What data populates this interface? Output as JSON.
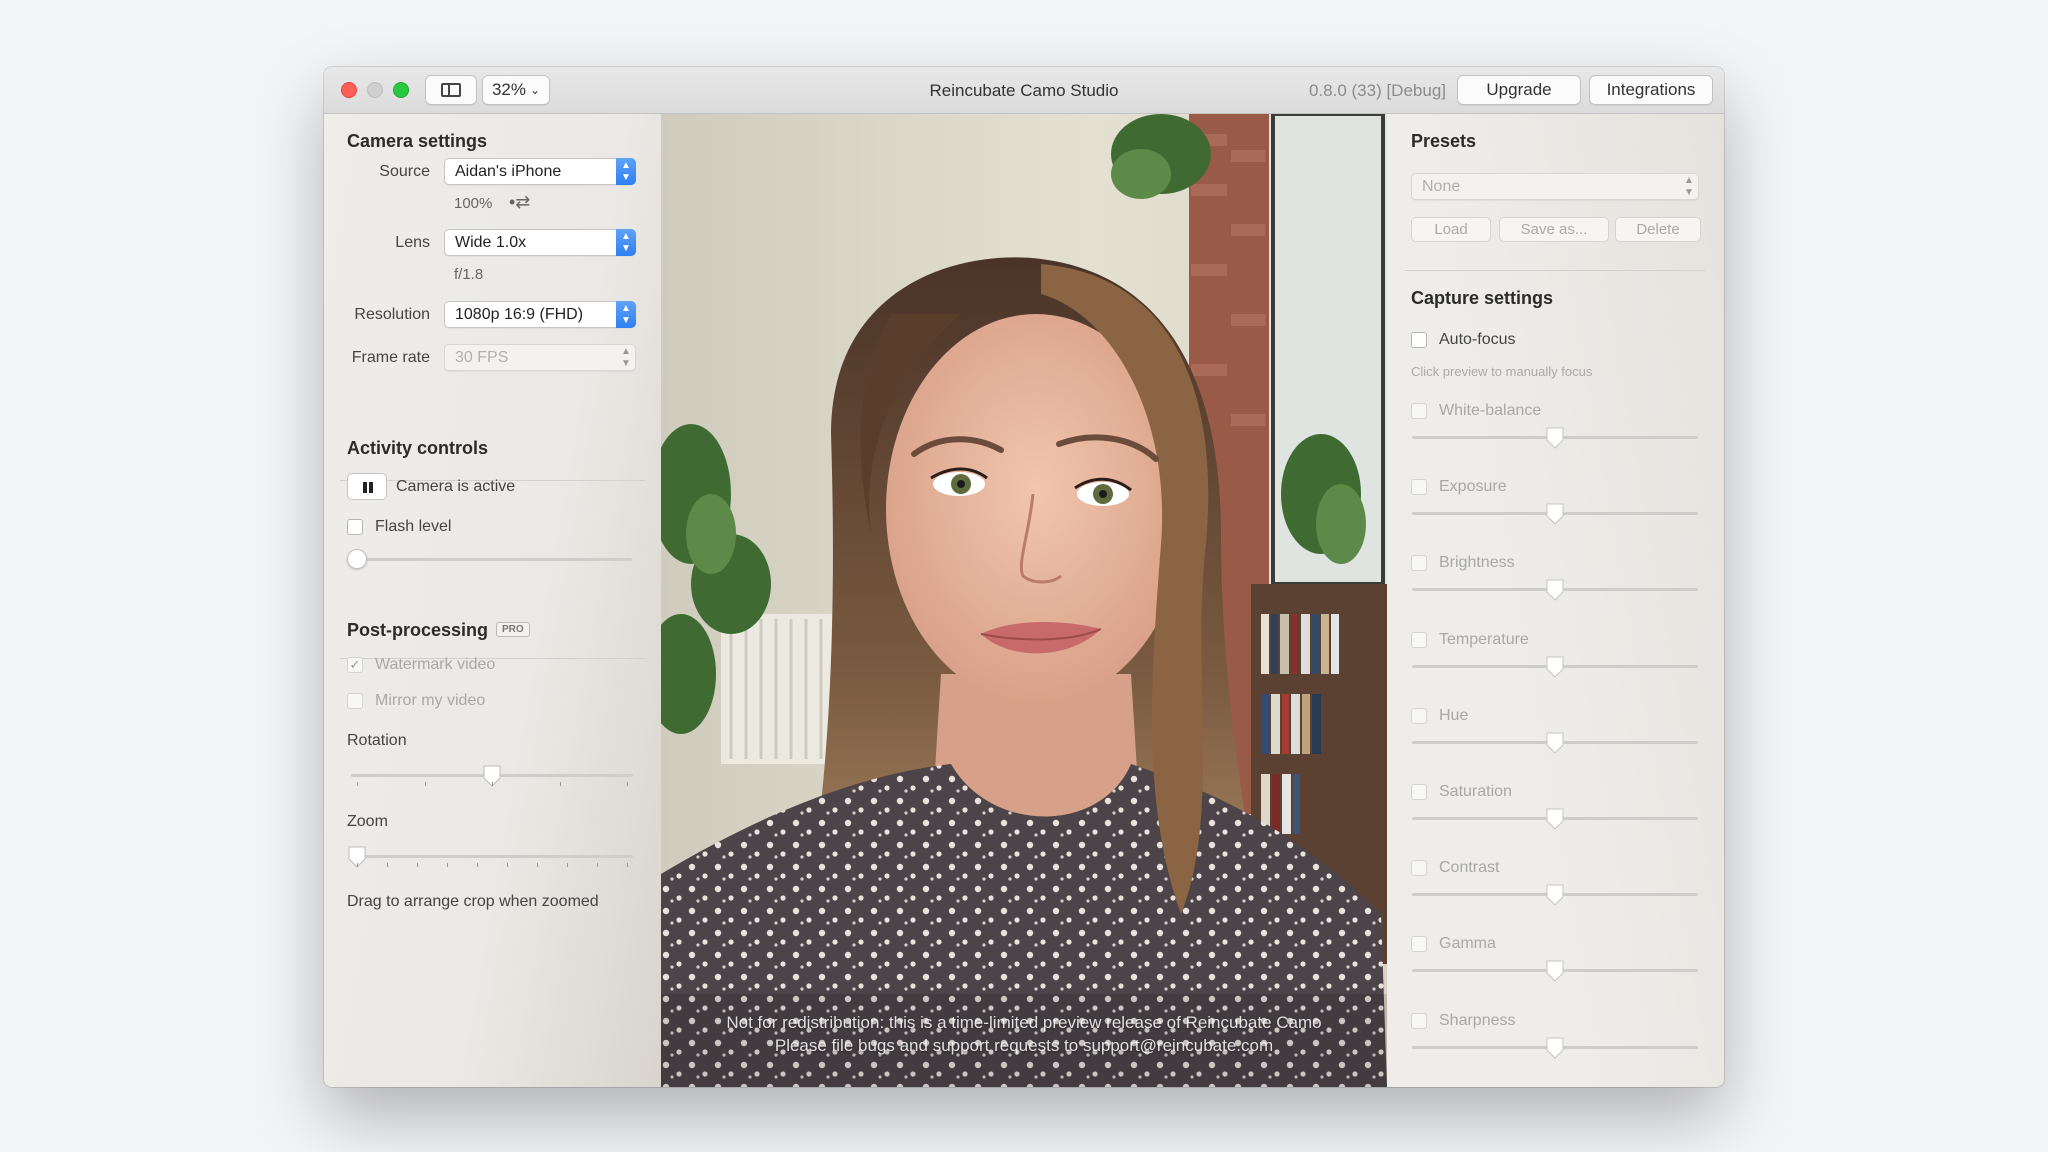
{
  "window": {
    "title": "Reincubate Camo Studio",
    "version": "0.8.0 (33) [Debug]",
    "zoom": "32%",
    "upgrade_label": "Upgrade",
    "integrations_label": "Integrations"
  },
  "camera_settings": {
    "title": "Camera settings",
    "source_label": "Source",
    "source_value": "Aidan's iPhone",
    "battery": "100%",
    "lens_label": "Lens",
    "lens_value": "Wide 1.0x",
    "aperture": "f/1.8",
    "resolution_label": "Resolution",
    "resolution_value": "1080p 16:9 (FHD)",
    "framerate_label": "Frame rate",
    "framerate_value": "30 FPS"
  },
  "activity_controls": {
    "title": "Activity controls",
    "camera_status": "Camera is active",
    "flash_label": "Flash level",
    "flash_level": 0
  },
  "post_processing": {
    "title": "Post-processing",
    "badge": "PRO",
    "watermark_label": "Watermark video",
    "watermark_checked": true,
    "mirror_label": "Mirror my video",
    "rotation_label": "Rotation",
    "rotation_value": 0.5,
    "zoom_label": "Zoom",
    "zoom_value": 0,
    "crop_hint": "Drag to arrange crop when zoomed"
  },
  "presets": {
    "title": "Presets",
    "selected": "None",
    "load_label": "Load",
    "save_label": "Save as...",
    "delete_label": "Delete"
  },
  "capture_settings": {
    "title": "Capture settings",
    "autofocus_label": "Auto-focus",
    "autofocus_hint": "Click preview to manually focus",
    "sliders": [
      {
        "label": "White-balance",
        "value": 0.5
      },
      {
        "label": "Exposure",
        "value": 0.5
      },
      {
        "label": "Brightness",
        "value": 0.5
      },
      {
        "label": "Temperature",
        "value": 0.5
      },
      {
        "label": "Hue",
        "value": 0.5
      },
      {
        "label": "Saturation",
        "value": 0.5
      },
      {
        "label": "Contrast",
        "value": 0.5
      },
      {
        "label": "Gamma",
        "value": 0.5
      },
      {
        "label": "Sharpness",
        "value": 0.5
      }
    ]
  },
  "preview": {
    "watermark_line1": "Not for redistribution: this is a time-limited preview release of Reincubate Camo",
    "watermark_line2": "Please file bugs and support requests to support@reincubate.com"
  },
  "colors": {
    "accent": "#2f7ef2",
    "close": "#fd5f57",
    "zoom_btn": "#29c840"
  }
}
